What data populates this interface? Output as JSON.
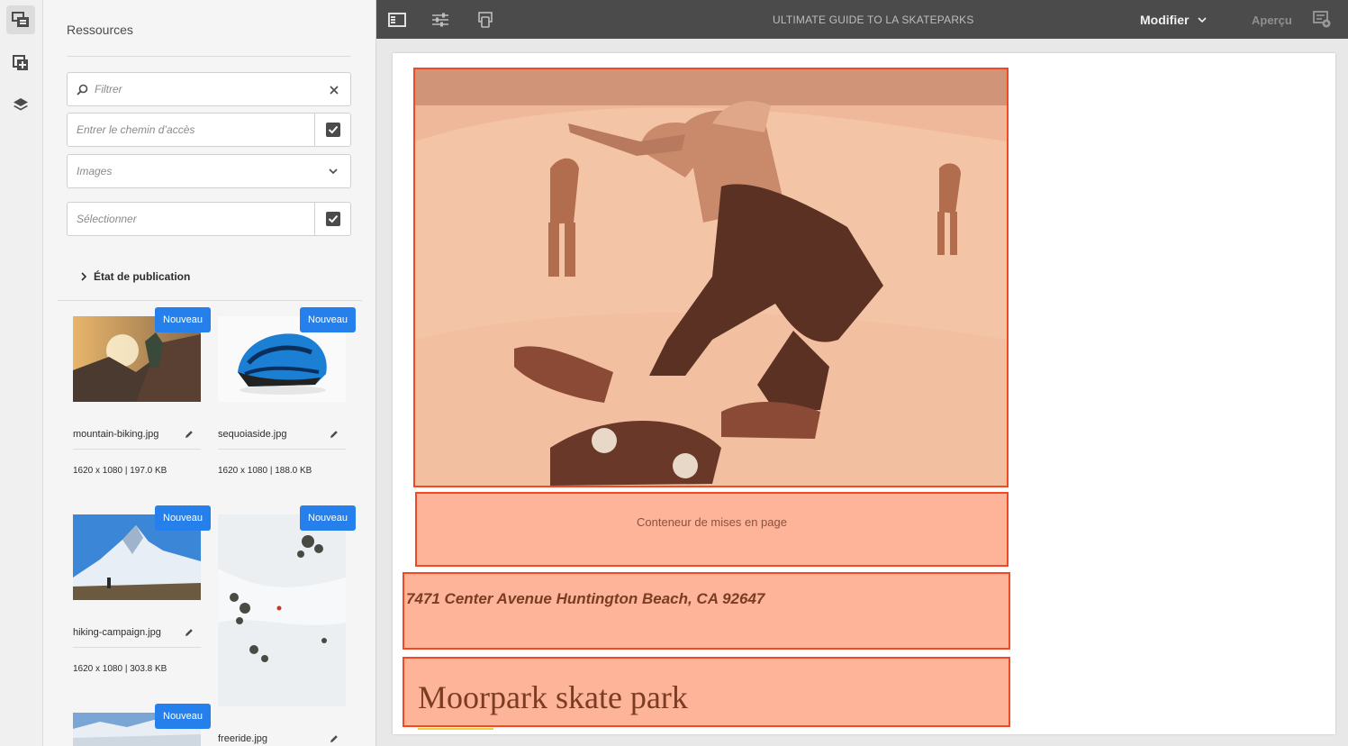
{
  "rail": {
    "items": [
      {
        "name": "assets-icon",
        "active": true
      },
      {
        "name": "components-icon",
        "active": false
      },
      {
        "name": "layers-icon",
        "active": false
      }
    ]
  },
  "panel": {
    "title": "Ressources",
    "filter_placeholder": "Filtrer",
    "path_placeholder": "Entrer le chemin d’accès",
    "type_value": "Images",
    "select_placeholder": "Sélectionner",
    "publication_label": "État de publication"
  },
  "assets": [
    {
      "badge": "Nouveau",
      "name": "mountain-biking.jpg",
      "meta": "1620 x 1080 | 197.0 KB"
    },
    {
      "badge": "Nouveau",
      "name": "sequoiaside.jpg",
      "meta": "1620 x 1080 | 188.0 KB"
    },
    {
      "badge": "Nouveau",
      "name": "hiking-campaign.jpg",
      "meta": "1620 x 1080 | 303.8 KB"
    },
    {
      "badge": "Nouveau",
      "name": "freeride.jpg",
      "meta": ""
    },
    {
      "badge": "Nouveau",
      "name": "",
      "meta": ""
    }
  ],
  "topbar": {
    "page_title": "ULTIMATE GUIDE TO LA SKATEPARKS",
    "mode": "Modifier",
    "preview": "Aperçu"
  },
  "canvas": {
    "layout_container_label": "Conteneur de mises en page",
    "address": "7471 Center Avenue Huntington Beach, CA 92647",
    "park_title": "Moorpark skate park"
  },
  "colors": {
    "accent": "#2680eb",
    "selection_border": "#f04a24",
    "selection_fill": "#fc946c",
    "topbar": "#4b4b4b"
  }
}
